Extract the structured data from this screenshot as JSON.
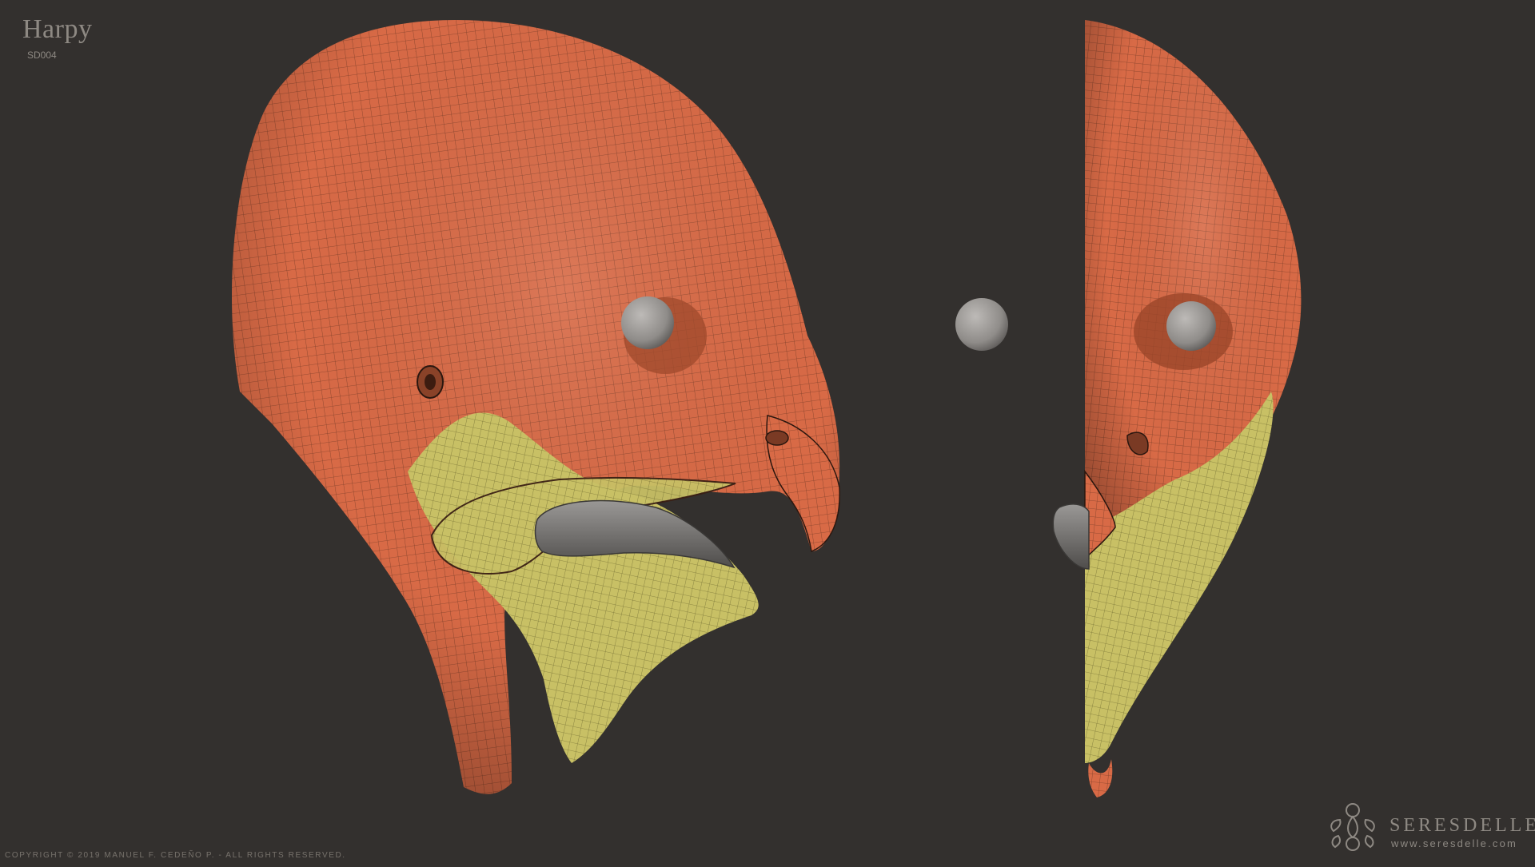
{
  "header": {
    "title": "Harpy",
    "code": "SD004"
  },
  "footer": {
    "copyright": "COPYRIGHT © 2019 MANUEL F. CEDEÑO P.  -  ALL RIGHTS RESERVED.",
    "brand_name": "SERESDELLE",
    "brand_url": "www.seresdelle.com"
  },
  "render": {
    "background": "#33302e",
    "skin_color": "#d86a46",
    "throat_color": "#c8c065",
    "eye_color": "#8f8c89",
    "horn_color": "#6f6d6b",
    "wire_color": "#3a1f14",
    "views": [
      "side-view",
      "front-view"
    ]
  }
}
